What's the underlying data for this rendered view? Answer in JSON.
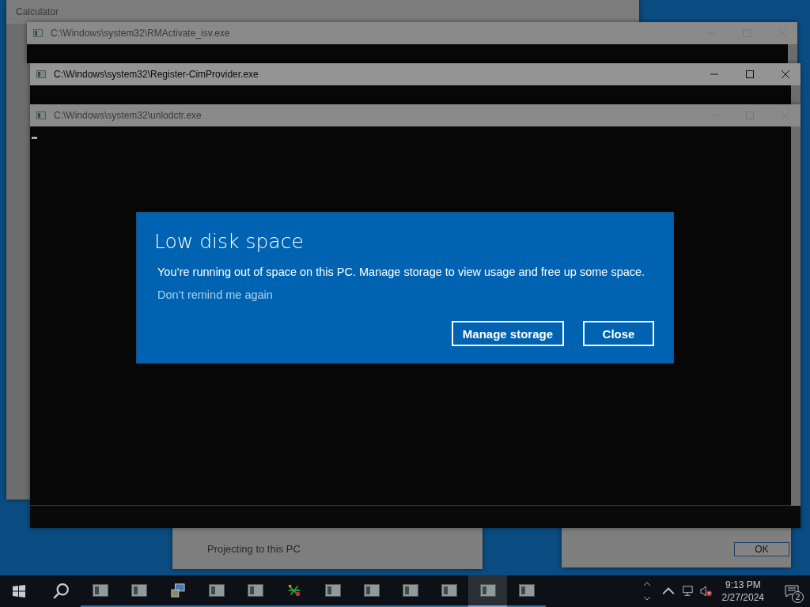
{
  "background_windows": {
    "calculator": {
      "title": "Calculator"
    },
    "settings_list": {
      "item": "Projecting to this PC"
    },
    "message_box": {
      "ok_button": "OK"
    }
  },
  "console_windows": [
    {
      "title": "C:\\Windows\\system32\\RMActivate_isv.exe",
      "active": false
    },
    {
      "title": "C:\\Windows\\system32\\Register-CimProvider.exe",
      "active": true
    },
    {
      "title": "C:\\Windows\\system32\\unlodctr.exe",
      "active": false
    }
  ],
  "dialog": {
    "title": "Low disk space",
    "message": "You’re running out of space on this PC. Manage storage to view usage and free up some space.",
    "link": "Don’t remind me again",
    "buttons": [
      "Manage storage",
      "Close"
    ]
  },
  "taskbar": {
    "apps": [
      {
        "kind": "console",
        "selected": false
      },
      {
        "kind": "console",
        "selected": false
      },
      {
        "kind": "installer",
        "selected": false
      },
      {
        "kind": "console",
        "selected": false
      },
      {
        "kind": "console",
        "selected": false
      },
      {
        "kind": "colorful",
        "selected": false
      },
      {
        "kind": "console",
        "selected": false
      },
      {
        "kind": "console",
        "selected": false
      },
      {
        "kind": "console",
        "selected": false
      },
      {
        "kind": "console",
        "selected": false
      },
      {
        "kind": "console",
        "selected": true
      },
      {
        "kind": "console",
        "selected": false
      }
    ],
    "time": "9:13 PM",
    "date": "2/27/2024",
    "notification_count": "2"
  }
}
